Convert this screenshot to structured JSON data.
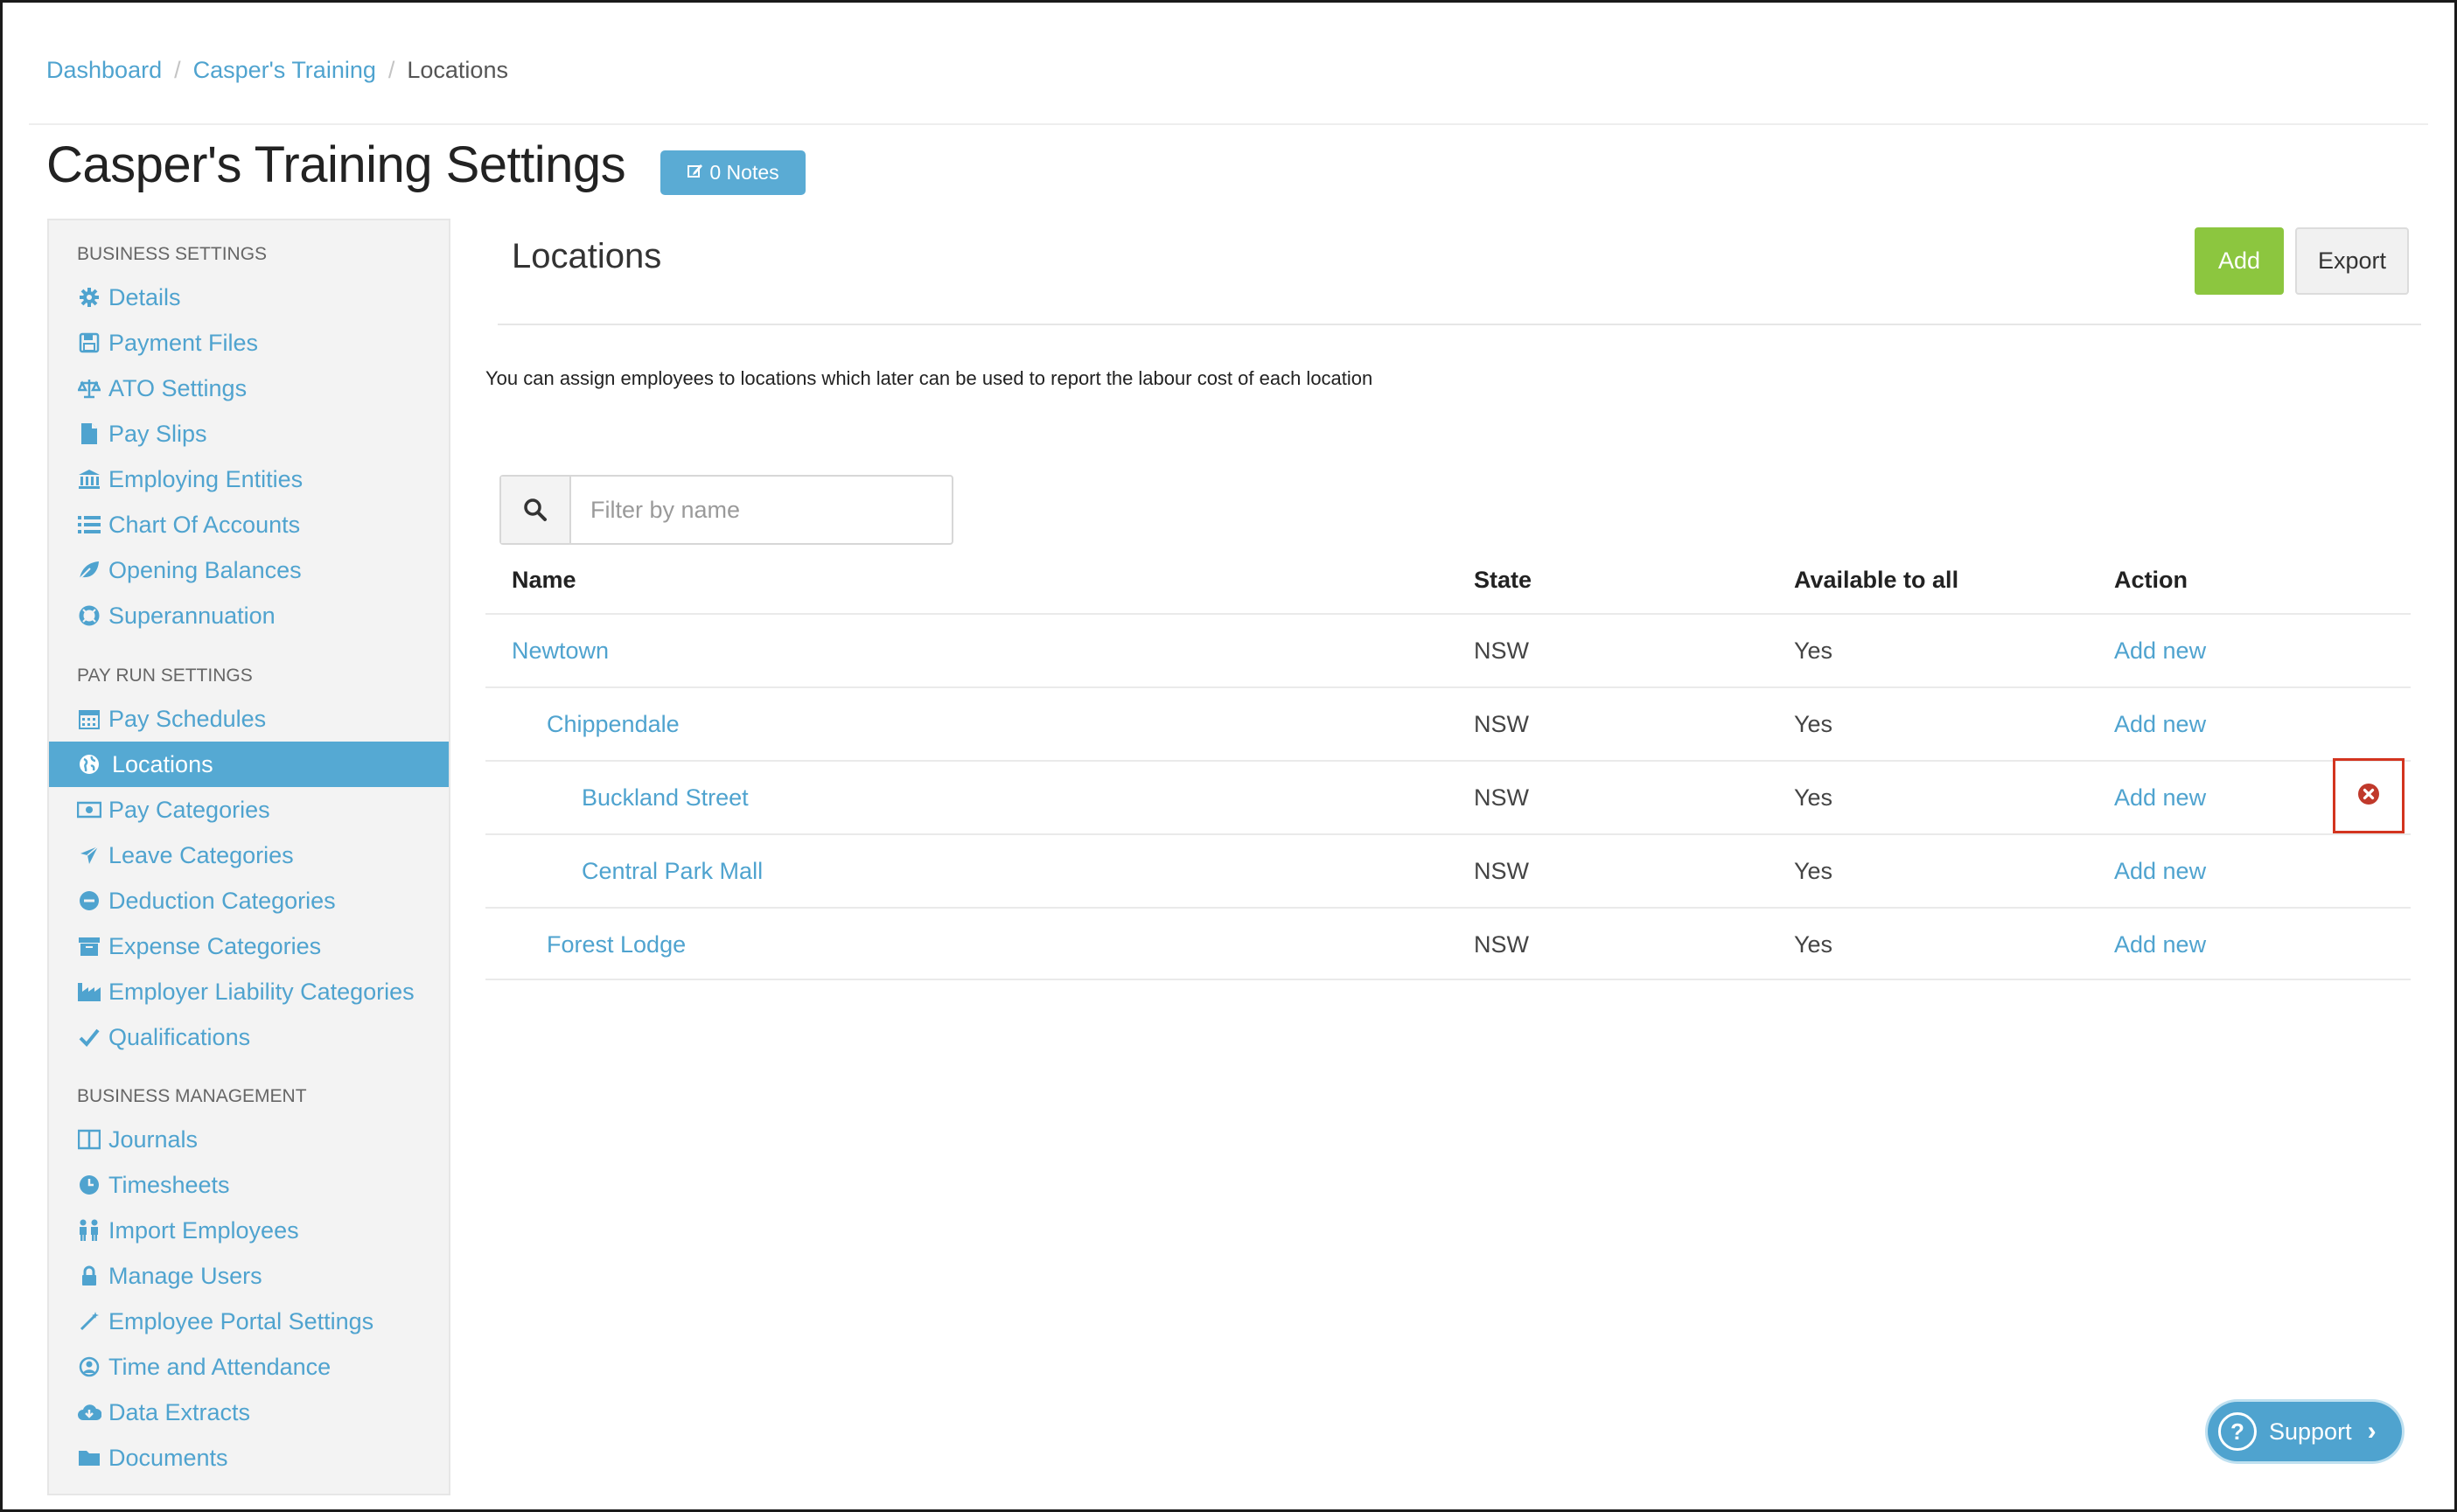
{
  "breadcrumb": {
    "items": [
      "Dashboard",
      "Casper's Training"
    ],
    "current": "Locations",
    "separator": "/"
  },
  "header": {
    "title": "Casper's Training Settings",
    "notes_badge": "0 Notes"
  },
  "sidebar": {
    "sections": [
      {
        "heading": "BUSINESS SETTINGS"
      },
      {
        "heading": "PAY RUN SETTINGS"
      },
      {
        "heading": "BUSINESS MANAGEMENT"
      }
    ],
    "items": [
      {
        "label": "Details",
        "icon": "gear-icon"
      },
      {
        "label": "Payment Files",
        "icon": "floppy-icon"
      },
      {
        "label": "ATO Settings",
        "icon": "scales-icon"
      },
      {
        "label": "Pay Slips",
        "icon": "file-icon"
      },
      {
        "label": "Employing Entities",
        "icon": "bank-icon"
      },
      {
        "label": "Chart Of Accounts",
        "icon": "list-icon"
      },
      {
        "label": "Opening Balances",
        "icon": "leaf-icon"
      },
      {
        "label": "Superannuation",
        "icon": "lifebuoy-icon"
      },
      {
        "label": "Pay Schedules",
        "icon": "calendar-icon"
      },
      {
        "label": "Locations",
        "icon": "globe-icon",
        "active": true
      },
      {
        "label": "Pay Categories",
        "icon": "money-icon"
      },
      {
        "label": "Leave Categories",
        "icon": "plane-icon"
      },
      {
        "label": "Deduction Categories",
        "icon": "minus-circle-icon"
      },
      {
        "label": "Expense Categories",
        "icon": "archive-icon"
      },
      {
        "label": "Employer Liability Categories",
        "icon": "industry-icon"
      },
      {
        "label": "Qualifications",
        "icon": "check-icon"
      },
      {
        "label": "Journals",
        "icon": "columns-icon"
      },
      {
        "label": "Timesheets",
        "icon": "clock-icon"
      },
      {
        "label": "Import Employees",
        "icon": "people-icon"
      },
      {
        "label": "Manage Users",
        "icon": "lock-icon"
      },
      {
        "label": "Employee Portal Settings",
        "icon": "magic-wand-icon"
      },
      {
        "label": "Time and Attendance",
        "icon": "user-circle-icon"
      },
      {
        "label": "Data Extracts",
        "icon": "cloud-download-icon"
      },
      {
        "label": "Documents",
        "icon": "folder-icon"
      }
    ]
  },
  "main": {
    "title": "Locations",
    "add_label": "Add",
    "export_label": "Export",
    "description": "You can assign employees to locations which later can be used to report the labour cost of each location",
    "search": {
      "placeholder": "Filter by name",
      "value": ""
    },
    "table": {
      "headers": [
        "Name",
        "State",
        "Available to all",
        "Action"
      ],
      "rows": [
        {
          "name": "Newtown",
          "level": 0,
          "state": "NSW",
          "available": "Yes",
          "action": "Add new"
        },
        {
          "name": "Chippendale",
          "level": 1,
          "state": "NSW",
          "available": "Yes",
          "action": "Add new"
        },
        {
          "name": "Buckland Street",
          "level": 2,
          "state": "NSW",
          "available": "Yes",
          "action": "Add new",
          "deletable": true
        },
        {
          "name": "Central Park Mall",
          "level": 2,
          "state": "NSW",
          "available": "Yes",
          "action": "Add new"
        },
        {
          "name": "Forest Lodge",
          "level": 1,
          "state": "NSW",
          "available": "Yes",
          "action": "Add new"
        }
      ]
    }
  },
  "support": {
    "label": "Support"
  },
  "colors": {
    "accent": "#4fa3cf",
    "active_nav": "#55a9d3",
    "add_button": "#8cc63f",
    "delete": "#c0392b",
    "highlight_box": "#d3341f"
  }
}
